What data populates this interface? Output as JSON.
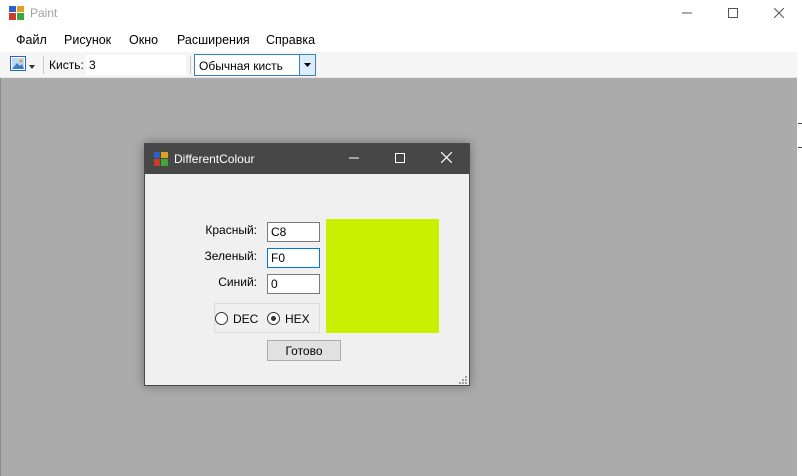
{
  "app": {
    "title": "Paint",
    "icon": "paint-app-icon"
  },
  "window_controls": [
    "minimize-icon",
    "maximize-icon",
    "close-icon"
  ],
  "menu": {
    "items": [
      "Файл",
      "Рисунок",
      "Окно",
      "Расширения",
      "Справка"
    ]
  },
  "toolbar": {
    "image_dropdown_icon": "image-icon",
    "brush_label": "Кисть:",
    "brush_size": "3",
    "brush_type": "Обычная кисть"
  },
  "dialog": {
    "title": "DifferentColour",
    "red_label": "Красный:",
    "red_value": "C8",
    "green_label": "Зеленый:",
    "green_value": "F0",
    "blue_label": "Синий:",
    "blue_value": "0",
    "radio_dec": "DEC",
    "radio_hex": "HEX",
    "selected_mode": "HEX",
    "done_label": "Готово",
    "preview_color": "#c8f000"
  },
  "colors": {
    "canvas_bg": "#ababab",
    "dialog_titlebar": "#474747",
    "focus_accent": "#0078d7"
  }
}
